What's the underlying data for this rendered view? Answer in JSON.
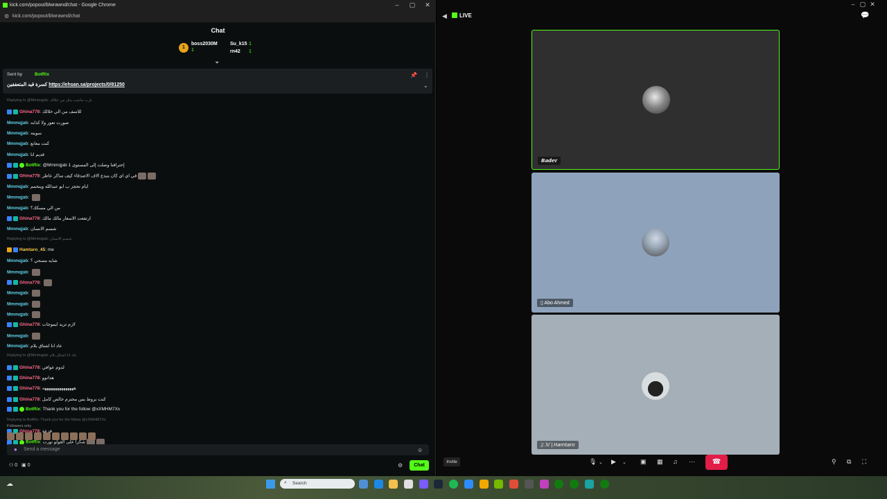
{
  "browser": {
    "title": "kick.com/popout/blwrawnd/chat - Google Chrome",
    "url": "kick.com/popout/blwrawnd/chat"
  },
  "chat": {
    "header": "Chat",
    "leaderboard": {
      "rank_badge": "1",
      "entries": [
        {
          "name": "boss2030M",
          "count": "1"
        },
        {
          "name": "Su_k15",
          "count": "1"
        },
        {
          "name": "rn42",
          "count": "1"
        }
      ]
    },
    "pinned": {
      "sent_by_label": "Sent by",
      "sender": "BotRix",
      "text": "كسرة قيد المتعففين",
      "link": "https://ehsan.sa/projects/0/81250"
    },
    "messages": [
      {
        "type": "reply",
        "text": "Replying to @Mmmqjab: يارب ماجيت مثل من خلالك"
      },
      {
        "user": "Ghina778",
        "color": "pink",
        "badges": [
          "blue",
          "teal"
        ],
        "text": "للاسف من الي خلالك"
      },
      {
        "user": "Mmmqjab",
        "color": "cyan",
        "badges": [],
        "text": "صورت تعور ولا كذابه"
      },
      {
        "user": "Mmmqjab",
        "color": "cyan",
        "badges": [],
        "text": "سويته"
      },
      {
        "user": "Mmmqjab",
        "color": "cyan",
        "badges": [],
        "text": "كنت معانع"
      },
      {
        "user": "Mmmqjab",
        "color": "cyan",
        "badges": [],
        "text": "قديم انا"
      },
      {
        "user": "BotRix",
        "color": "green",
        "badges": [
          "blue",
          "teal",
          "green"
        ],
        "text": "@Mmmqjab إحترافنا وصلت إلى المستوى 1"
      },
      {
        "user": "Ghina778",
        "color": "pink",
        "badges": [
          "blue",
          "teal"
        ],
        "text": "في اي اي كان مبدع الاف الاصدقاء كيف ساكر عاطر",
        "emotes": 2
      },
      {
        "user": "Mmmqjab",
        "color": "cyan",
        "badges": [],
        "text": "ايام تحجز ب ابو عبدالله وينحمم"
      },
      {
        "user": "Mmmqjab",
        "color": "cyan",
        "badges": [],
        "text": "",
        "emotes": 1
      },
      {
        "user": "Mmmqjab",
        "color": "cyan",
        "badges": [],
        "text": "من الي مسكك؟"
      },
      {
        "user": "Ghina778",
        "color": "pink",
        "badges": [
          "blue",
          "teal"
        ],
        "text": "ارتفعت الاسعار مالك مالك"
      },
      {
        "user": "Mmmqjab",
        "color": "cyan",
        "badges": [],
        "text": "شسم الانسان"
      },
      {
        "type": "reply",
        "text": "Replying to @Mmmqjab: شسم الانسان"
      },
      {
        "user": "Hamtaro_45",
        "color": "gold",
        "badges": [
          "gold",
          "blue"
        ],
        "text": "me"
      },
      {
        "user": "Mmmqjab",
        "color": "cyan",
        "badges": [],
        "text": "شايه مسحي ؟"
      },
      {
        "user": "Mmmqjab",
        "color": "cyan",
        "badges": [],
        "text": "",
        "emotes": 1
      },
      {
        "user": "Ghina778",
        "color": "pink",
        "badges": [
          "blue",
          "teal"
        ],
        "text": "",
        "emotes": 1
      },
      {
        "user": "Mmmqjab",
        "color": "cyan",
        "badges": [],
        "text": "",
        "emotes": 1
      },
      {
        "user": "Mmmqjab",
        "color": "cyan",
        "badges": [],
        "text": "",
        "emotes": 1
      },
      {
        "user": "Mmmqjab",
        "color": "cyan",
        "badges": [],
        "text": "",
        "emotes": 1
      },
      {
        "user": "Ghina778",
        "color": "pink",
        "badges": [
          "blue",
          "teal"
        ],
        "text": "لازم تزيد ايموجات"
      },
      {
        "user": "Mmmqjab",
        "color": "cyan",
        "badges": [],
        "text": "",
        "emotes": 1
      },
      {
        "user": "Mmmqjab",
        "color": "cyan",
        "badges": [],
        "text": "عاد انا اشتاق بلام"
      },
      {
        "type": "reply",
        "text": "Replying to @Mmmqjab: عاد انا اشتاق بلام"
      },
      {
        "user": "Ghina778",
        "color": "pink",
        "badges": [
          "blue",
          "teal"
        ],
        "text": "لدوم عوافي"
      },
      {
        "user": "Ghina778",
        "color": "pink",
        "badges": [
          "blue",
          "teal"
        ],
        "text": "هدانوو"
      },
      {
        "user": "Ghina778",
        "color": "pink",
        "badges": [
          "blue",
          "teal"
        ],
        "text": "هههههههههههههههه"
      },
      {
        "user": "Ghina778",
        "color": "pink",
        "badges": [
          "blue",
          "teal"
        ],
        "text": "كنت بزوط بس محترم خالص كامل"
      },
      {
        "user": "BotRix",
        "color": "green",
        "badges": [
          "blue",
          "teal",
          "green"
        ],
        "text": "Thank you for the follow @xXMHM7Xx"
      },
      {
        "type": "reply",
        "text": "Replying to BotRix: Thank you for the follow @xXMHM7Xx"
      },
      {
        "user": "Ghina778",
        "color": "pink",
        "badges": [
          "blue",
          "teal"
        ],
        "text": "فزعة"
      },
      {
        "user": "BotRix",
        "color": "green",
        "badges": [
          "blue",
          "teal",
          "green"
        ],
        "text": "شكرا على الفولو نورت",
        "emotes": 2
      }
    ],
    "followers_only_label": "Followers only",
    "input_placeholder": "Send a message",
    "footer_count": "0",
    "footer_points": "0",
    "chat_button": "Chat"
  },
  "call": {
    "live_label": "LIVE",
    "participants": [
      {
        "name": "𝘽𝙖𝙙𝙚𝙧"
      },
      {
        "name": "Abo Ahmed"
      },
      {
        "name": "ℳ | 𝘏𝘢𝘮𝘵𝘢𝘳𝘰"
      }
    ],
    "invite_label": "Invite"
  },
  "taskbar": {
    "search_placeholder": "Search"
  }
}
